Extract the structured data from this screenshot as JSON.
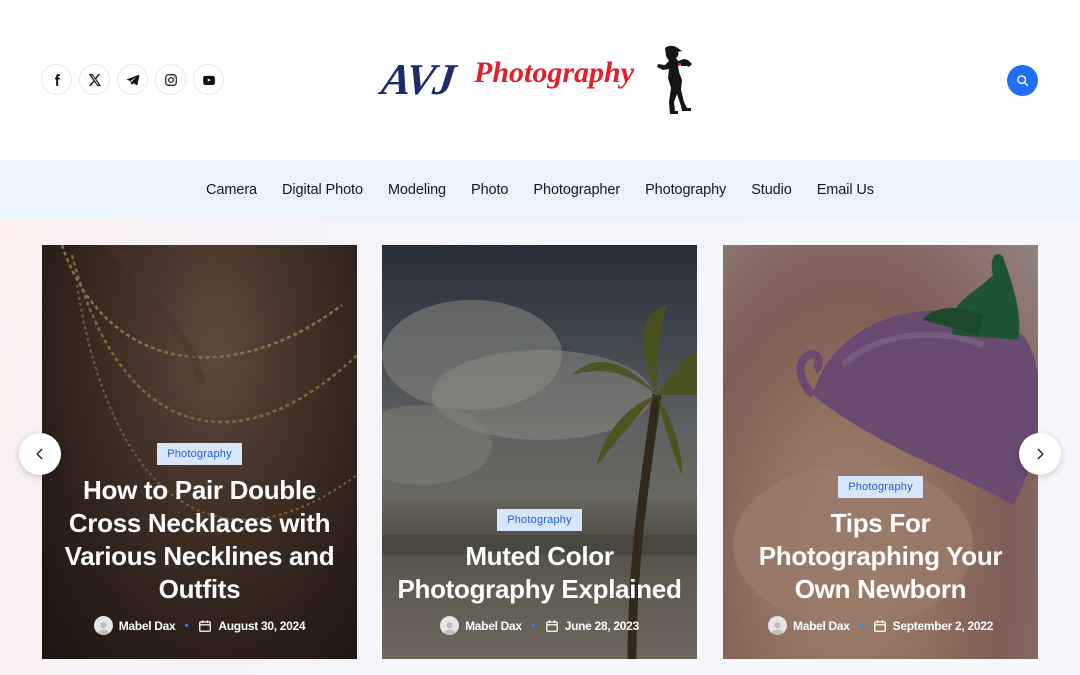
{
  "social": [
    {
      "icon": "facebook-icon"
    },
    {
      "icon": "x-twitter-icon"
    },
    {
      "icon": "telegram-icon"
    },
    {
      "icon": "instagram-icon"
    },
    {
      "icon": "youtube-icon"
    }
  ],
  "logo": {
    "part1": "AVJ",
    "part2": "Photography"
  },
  "nav": {
    "items": [
      "Camera",
      "Digital Photo",
      "Modeling",
      "Photo",
      "Photographer",
      "Photography",
      "Studio",
      "Email Us"
    ]
  },
  "posts": [
    {
      "category": "Photography",
      "title": "How to Pair Double Cross Necklaces with Various Necklines and Outfits",
      "author": "Mabel Dax",
      "date": "August 30, 2024"
    },
    {
      "category": "Photography",
      "title": "Muted Color Photography Explained",
      "author": "Mabel Dax",
      "date": "June 28, 2023"
    },
    {
      "category": "Photography",
      "title": "Tips For Photographing Your Own Newborn",
      "author": "Mabel Dax",
      "date": "September 2, 2022"
    }
  ],
  "colors": {
    "accent": "#1f6ff5",
    "nav_bg": "#edf3fb",
    "logo_blue": "#1d2a6b",
    "logo_red": "#e3202a"
  }
}
